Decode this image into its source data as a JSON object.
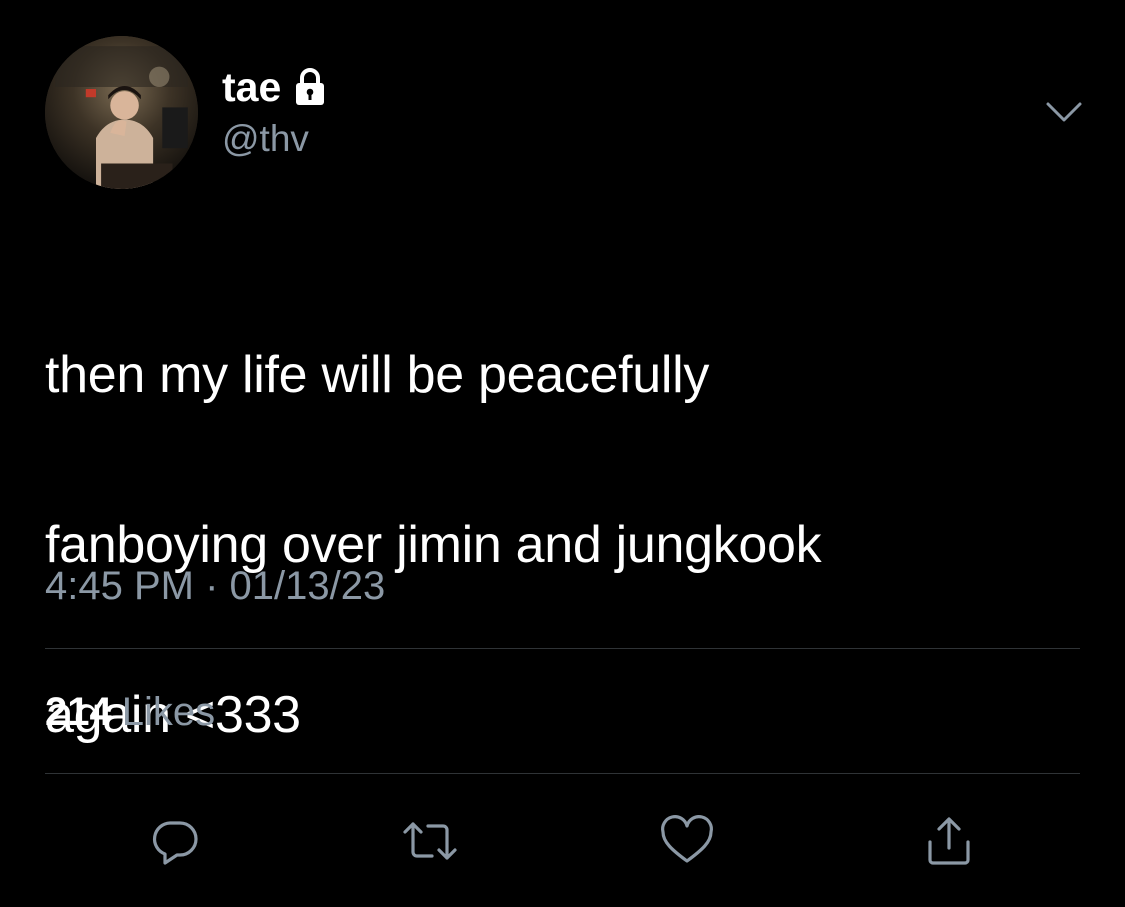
{
  "author": {
    "display_name": "tae",
    "handle": "@thv",
    "protected_icon": "lock-icon",
    "avatar": "profile-photo"
  },
  "menu_icon": "chevron-down-icon",
  "tweet": {
    "lines": [
      "then my life will be peacefully",
      "fanboying over jimin and jungkook",
      "again <333"
    ],
    "timestamp": "4:45 PM · 01/13/23"
  },
  "stats": {
    "likes_count": "214",
    "likes_label": "Likes"
  },
  "actions": {
    "reply_icon": "reply-icon",
    "retweet_icon": "retweet-icon",
    "like_icon": "heart-icon",
    "share_icon": "share-icon"
  },
  "colors": {
    "background": "#000000",
    "text_primary": "#ffffff",
    "text_secondary": "#8b98a5",
    "divider": "#2f3336"
  }
}
